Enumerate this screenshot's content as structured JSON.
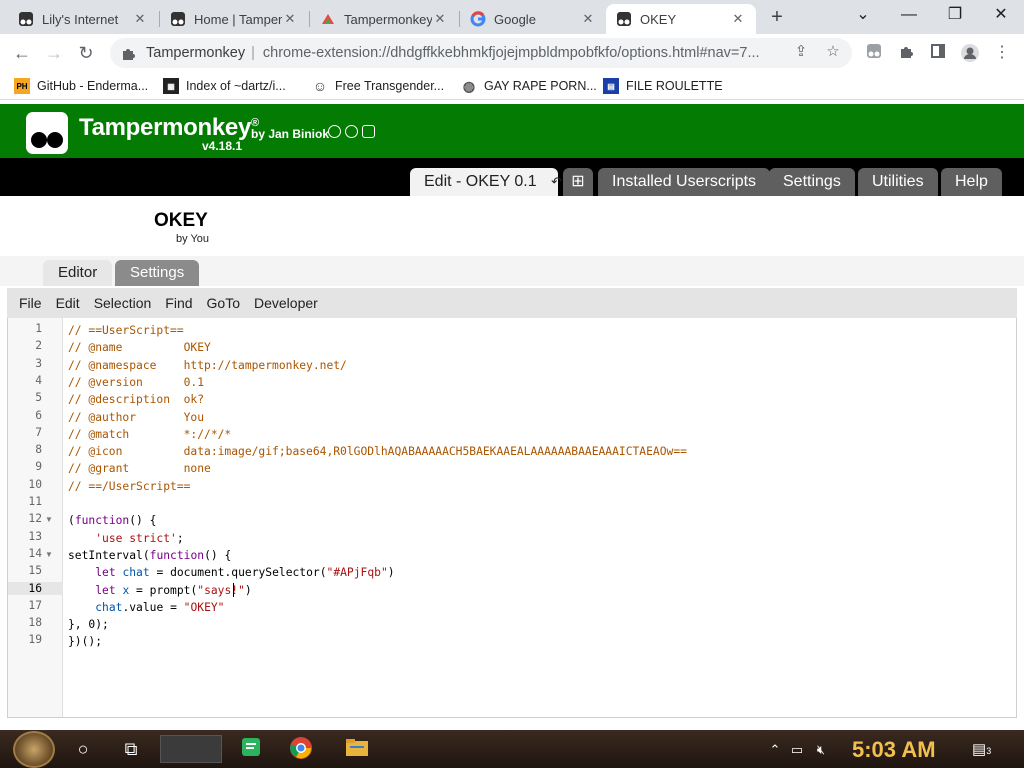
{
  "browser": {
    "tabs": [
      {
        "title": "Lily's Internet",
        "icon": "tampermonkey-icon"
      },
      {
        "title": "Home | Tamper",
        "icon": "tampermonkey-icon"
      },
      {
        "title": "Tampermonkey",
        "icon": "rainbow-icon"
      },
      {
        "title": "Google",
        "icon": "google-icon"
      },
      {
        "title": "OKEY",
        "icon": "tampermonkey-icon"
      }
    ],
    "new_tab_label": "+",
    "origin": "Tampermonkey",
    "url": "chrome-extension://dhdgffkkebhmkfjojejmpbldmpobfkfo/options.html#nav=7..."
  },
  "bookmarks": [
    {
      "label": "GitHub - Enderma...",
      "icon": "ph-icon"
    },
    {
      "label": "Index of ~dartz/i...",
      "icon": "pixel-icon"
    },
    {
      "label": "Free Transgender...",
      "icon": "mask-icon"
    },
    {
      "label": "GAY RAPE PORN...",
      "icon": "globe-icon"
    },
    {
      "label": "FILE ROULETTE",
      "icon": "file-icon"
    }
  ],
  "tm": {
    "brand": "Tampermonkey",
    "registered": "®",
    "by": "by Jan Biniok",
    "version": "v4.18.1",
    "nav": {
      "edit_tab": "Edit - OKEY 0.1",
      "add_tab": "⊞",
      "installed": "Installed Userscripts",
      "settings": "Settings",
      "utilities": "Utilities",
      "help": "Help"
    },
    "script_name": "OKEY",
    "script_author": "by You",
    "subtabs": {
      "editor": "Editor",
      "settings": "Settings"
    },
    "menu": [
      "File",
      "Edit",
      "Selection",
      "Find",
      "GoTo",
      "Developer"
    ]
  },
  "editor": {
    "current_line": 16,
    "lines": [
      "// ==UserScript==",
      "// @name         OKEY",
      "// @namespace    http://tampermonkey.net/",
      "// @version      0.1",
      "// @description  ok?",
      "// @author       You",
      "// @match        *://*/*",
      "// @icon         data:image/gif;base64,R0lGODlhAQABAAAAACH5BAEKAAEALAAAAAABAAEAAAICTAEAOw==",
      "// @grant        none",
      "// ==/UserScript==",
      "",
      "(function() {",
      "    'use strict';",
      "setInterval(function() {",
      "    let chat = document.querySelector(\"#APjFqb\")",
      "    let x = prompt(\"says!\")",
      "    chat.value = \"OKEY\"",
      "}, 0);",
      "})();"
    ]
  },
  "taskbar": {
    "time": "5:03 AM",
    "notification_count": "3"
  }
}
